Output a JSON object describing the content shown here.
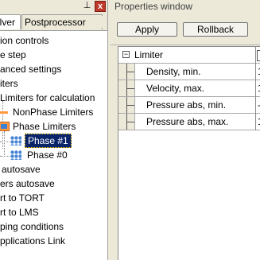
{
  "left_panel": {
    "pin_icon": "pin-icon",
    "close_label": "x",
    "tabs": [
      {
        "label": "Solver"
      },
      {
        "label": "Postprocessor"
      }
    ],
    "tree": [
      {
        "label": "ion controls"
      },
      {
        "label": "e step"
      },
      {
        "label": "anced settings"
      },
      {
        "label": "iters"
      },
      {
        "label": "Limiters for calculation"
      },
      {
        "label": "NonPhase Limiters"
      },
      {
        "label": "Phase Limiters"
      },
      {
        "label": "Phase #1"
      },
      {
        "label": "Phase #0"
      },
      {
        "label": "autosave"
      },
      {
        "label": "ers autosave"
      },
      {
        "label": "rt to TORT"
      },
      {
        "label": "rt to LMS"
      },
      {
        "label": "ping conditions"
      },
      {
        "label": "pplications Link"
      }
    ]
  },
  "right_panel": {
    "title": "Properties window",
    "toolbar": {
      "apply_label": "Apply",
      "rollback_label": "Rollback"
    },
    "grid": {
      "group": {
        "label": "Limiter",
        "expander": "−"
      },
      "rows": [
        {
          "label": "Density, min.",
          "value": "1"
        },
        {
          "label": "Velocity, max.",
          "value": "1"
        },
        {
          "label": "Pressure abs, min.",
          "value": "-"
        },
        {
          "label": "Pressure abs, max.",
          "value": "1"
        }
      ]
    }
  }
}
